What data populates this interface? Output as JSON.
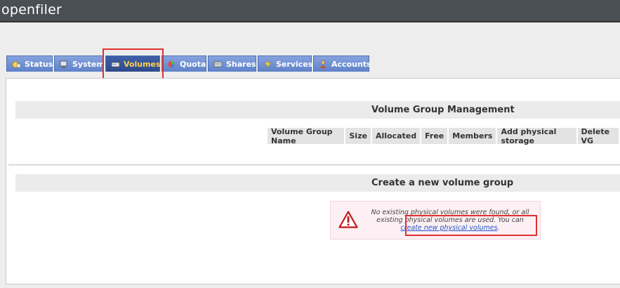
{
  "app": {
    "logo": "openfiler"
  },
  "tabs": [
    {
      "label": "Status",
      "icon": "status-icon",
      "active": false
    },
    {
      "label": "System",
      "icon": "system-icon",
      "active": false
    },
    {
      "label": "Volumes",
      "icon": "volumes-icon",
      "active": true
    },
    {
      "label": "Quota",
      "icon": "quota-icon",
      "active": false
    },
    {
      "label": "Shares",
      "icon": "shares-icon",
      "active": false
    },
    {
      "label": "Services",
      "icon": "services-icon",
      "active": false
    },
    {
      "label": "Accounts",
      "icon": "accounts-icon",
      "active": false
    }
  ],
  "vg_management": {
    "title": "Volume Group Management",
    "columns": [
      "Volume Group Name",
      "Size",
      "Allocated",
      "Free",
      "Members",
      "Add physical storage",
      "Delete VG"
    ]
  },
  "create_vg": {
    "title": "Create a new volume group",
    "message_line1": "No existing physical volumes were found, or all",
    "message_line2": "existing physical volumes are used. You can",
    "link_text": "create new physical volumes",
    "message_end": "."
  },
  "colors": {
    "topbar": "#4a4f54",
    "tab": "#6f8fd0",
    "tab_active": "#2f4a8a",
    "tab_active_text": "#ffd24a",
    "highlight": "#e03030",
    "alert_bg": "#fdf0f4"
  }
}
